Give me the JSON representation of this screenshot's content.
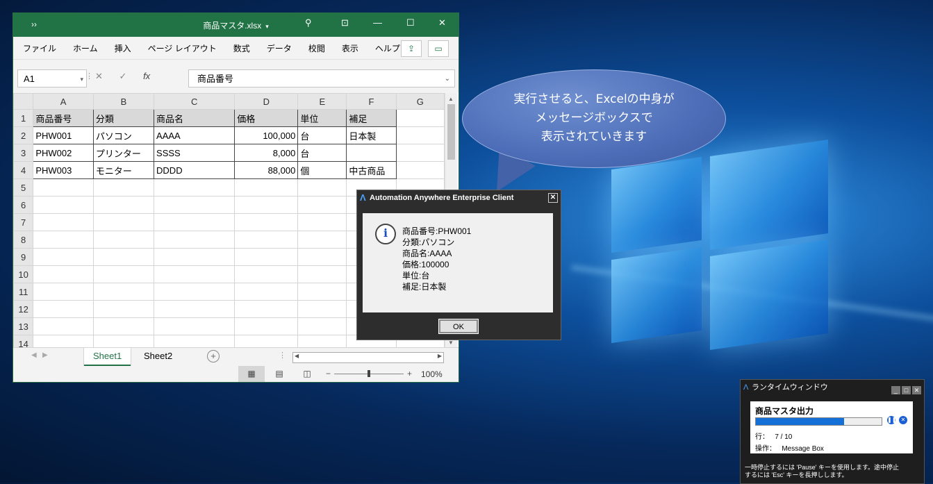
{
  "excel": {
    "window_title": "商品マスタ.xlsx",
    "qat": "››",
    "menu": [
      "ファイル",
      "ホーム",
      "挿入",
      "ページ レイアウト",
      "数式",
      "データ",
      "校閲",
      "表示",
      "ヘルプ"
    ],
    "name_box": "A1",
    "formula_value": "商品番号",
    "columns": [
      "A",
      "B",
      "C",
      "D",
      "E",
      "F",
      "G"
    ],
    "rows": [
      [
        "商品番号",
        "分類",
        "商品名",
        "価格",
        "単位",
        "補足"
      ],
      [
        "PHW001",
        "パソコン",
        "AAAA",
        "100,000",
        "台",
        "日本製"
      ],
      [
        "PHW002",
        "プリンター",
        "SSSS",
        "8,000",
        "台",
        ""
      ],
      [
        "PHW003",
        "モニター",
        "DDDD",
        "88,000",
        "個",
        "中古商品"
      ]
    ],
    "row_numbers": [
      "1",
      "2",
      "3",
      "4",
      "5",
      "6",
      "7",
      "8",
      "9",
      "10",
      "11",
      "12",
      "13",
      "14"
    ],
    "sheet_tabs": [
      "Sheet1",
      "Sheet2"
    ],
    "zoom": "100%"
  },
  "bubble": {
    "line1": "実行させると、Excelの中身が",
    "line2": "メッセージボックスで",
    "line3": "表示されていきます"
  },
  "message_box": {
    "title": "Automation Anywhere Enterprise Client",
    "lines": [
      "商品番号:PHW001",
      "分類:パソコン",
      "商品名:AAAA",
      "価格:100000",
      "単位:台",
      "補足:日本製"
    ],
    "ok_label": "OK"
  },
  "runtime": {
    "title": "ランタイムウィンドウ",
    "task_name": "商品マスタ出力",
    "progress": 0.7,
    "row_label": "行：",
    "row_value": "7 / 10",
    "op_label": "操作：",
    "op_value": "Message Box",
    "note1": "一時停止するには 'Pause' キーを使用します。途中停止",
    "note2": "するには 'Esc' キーを長押しします。"
  }
}
